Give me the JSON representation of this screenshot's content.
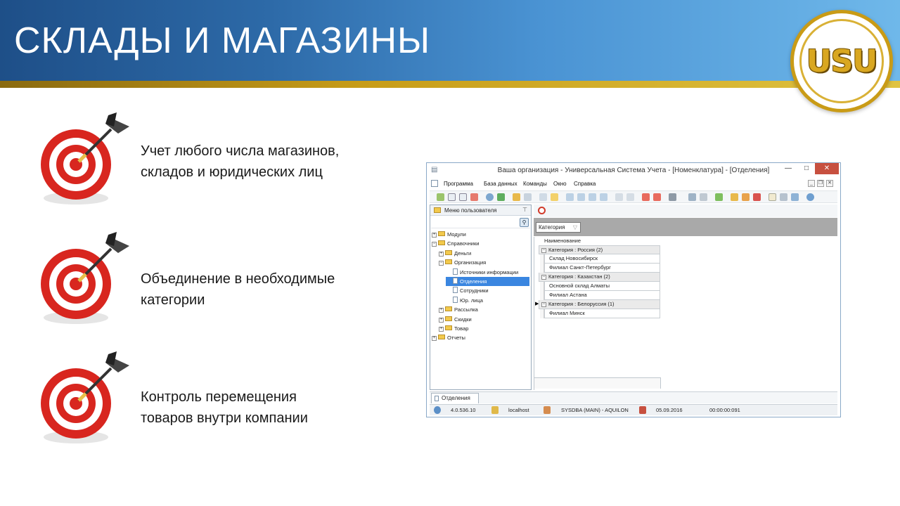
{
  "slide": {
    "title": "СКЛАДЫ И МАГАЗИНЫ",
    "logo_text": "USU",
    "bullets": [
      {
        "line1": "Учет любого числа магазинов,",
        "line2": "складов и юридических лиц"
      },
      {
        "line1": "Объединение в необходимые",
        "line2": "категории"
      },
      {
        "line1": "Контроль перемещения",
        "line2": "товаров внутри компании"
      }
    ]
  },
  "window": {
    "title": "Ваша организация - Универсальная Система Учета - [Номенклатура] - [Отделения]",
    "controls": {
      "minimize": "—",
      "maximize": "□",
      "close": "✕"
    },
    "menu": [
      "Программа",
      "База данных",
      "Команды",
      "Окно",
      "Справка"
    ],
    "mdi_controls": [
      "_",
      "❐",
      "✕"
    ],
    "left_panel": {
      "header": "Меню пользователя",
      "pin": "⊤",
      "tree": [
        {
          "label": "Модули",
          "exp": "+",
          "level": 0,
          "icon": "folder"
        },
        {
          "label": "Справочники",
          "exp": "−",
          "level": 0,
          "icon": "folder"
        },
        {
          "label": "Деньги",
          "exp": "+",
          "level": 1,
          "icon": "folder"
        },
        {
          "label": "Организация",
          "exp": "−",
          "level": 1,
          "icon": "folder"
        },
        {
          "label": "Источники информации",
          "exp": "",
          "level": 2,
          "icon": "doc"
        },
        {
          "label": "Отделения",
          "exp": "",
          "level": 2,
          "icon": "doc",
          "selected": true
        },
        {
          "label": "Сотрудники",
          "exp": "",
          "level": 2,
          "icon": "doc"
        },
        {
          "label": "Юр. лица",
          "exp": "",
          "level": 2,
          "icon": "doc"
        },
        {
          "label": "Рассылка",
          "exp": "+",
          "level": 1,
          "icon": "folder"
        },
        {
          "label": "Скидки",
          "exp": "+",
          "level": 1,
          "icon": "folder"
        },
        {
          "label": "Товар",
          "exp": "+",
          "level": 1,
          "icon": "folder"
        },
        {
          "label": "Отчеты",
          "exp": "+",
          "level": 0,
          "icon": "folder"
        }
      ]
    },
    "group_chip": "Категория",
    "grid": {
      "column": "Наименование",
      "rows": [
        {
          "type": "group",
          "text": "Категория : Россия (2)"
        },
        {
          "type": "item",
          "text": "Склад Новосибирск"
        },
        {
          "type": "item",
          "text": "Филиал Санкт-Петербург"
        },
        {
          "type": "group",
          "text": "Категория : Казахстан (2)"
        },
        {
          "type": "item",
          "text": "Основной склад Алматы"
        },
        {
          "type": "item",
          "text": "Филиал Астана"
        },
        {
          "type": "group",
          "text": "Категория : Белоруссия (1)",
          "current": true
        },
        {
          "type": "item",
          "text": "Филиал Минск"
        }
      ]
    },
    "tab": "Отделения",
    "status": {
      "version": "4.0.536.10",
      "server": "localhost",
      "user": "SYSDBA (MAIN) - AQUILON",
      "date": "05.09.2016",
      "timer": "00:00:00:091"
    }
  }
}
